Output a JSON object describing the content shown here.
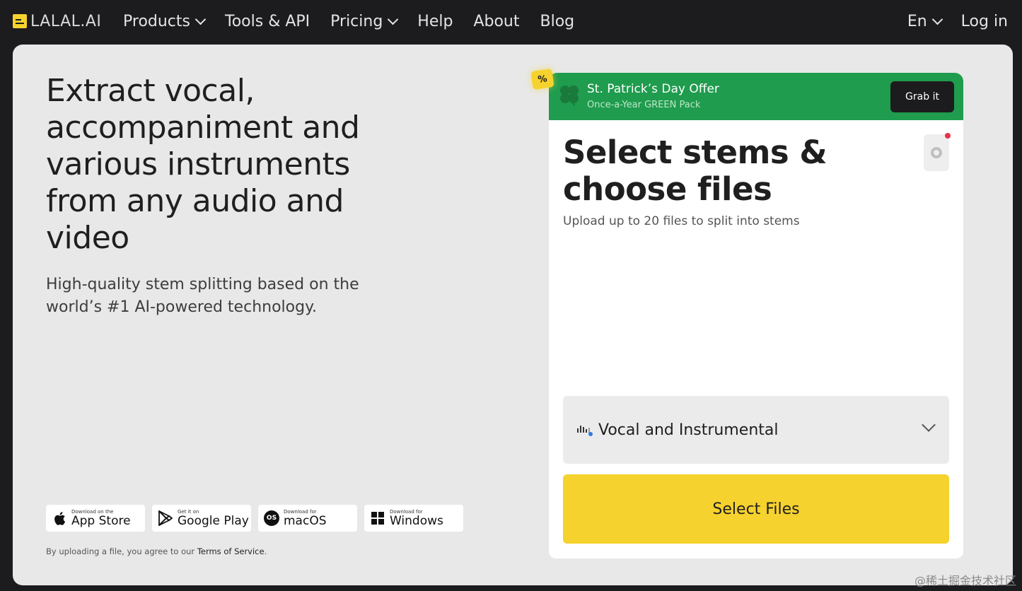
{
  "nav": {
    "logo": "LALAL.AI",
    "items": [
      {
        "label": "Products",
        "dropdown": true
      },
      {
        "label": "Tools & API",
        "dropdown": false
      },
      {
        "label": "Pricing",
        "dropdown": true
      },
      {
        "label": "Help",
        "dropdown": false
      },
      {
        "label": "About",
        "dropdown": false
      },
      {
        "label": "Blog",
        "dropdown": false
      }
    ],
    "language": "En",
    "login": "Log in"
  },
  "hero": {
    "headline": "Extract vocal, accompaniment and various instruments from any audio and video",
    "subline": "High-quality stem splitting based on the world’s #1 AI-powered technology."
  },
  "stores": [
    {
      "small": "Download on the",
      "big": "App Store",
      "icon": "apple-icon"
    },
    {
      "small": "Get it on",
      "big": "Google Play",
      "icon": "google-play-icon"
    },
    {
      "small": "Download for",
      "big": "macOS",
      "icon": "macos-icon"
    },
    {
      "small": "Download for",
      "big": "Windows",
      "icon": "windows-icon"
    }
  ],
  "terms": {
    "prefix": "By uploading a file, you agree to our ",
    "link": "Terms of Service",
    "suffix": "."
  },
  "offer": {
    "tag": "%",
    "title": "St. Patrick’s Day Offer",
    "subtitle": "Once-a-Year GREEN Pack",
    "button": "Grab it"
  },
  "upload": {
    "title": "Select stems & choose files",
    "subtitle": "Upload up to 20 files to split into stems",
    "stem_option": "Vocal and Instrumental",
    "select_button": "Select Files"
  },
  "watermark": "@稀土掘金技术社区",
  "colors": {
    "accent_yellow": "#f6d22e",
    "offer_green": "#1f9c4e",
    "background_dark": "#1c1b1d",
    "card_bg": "#e8e8e8"
  }
}
